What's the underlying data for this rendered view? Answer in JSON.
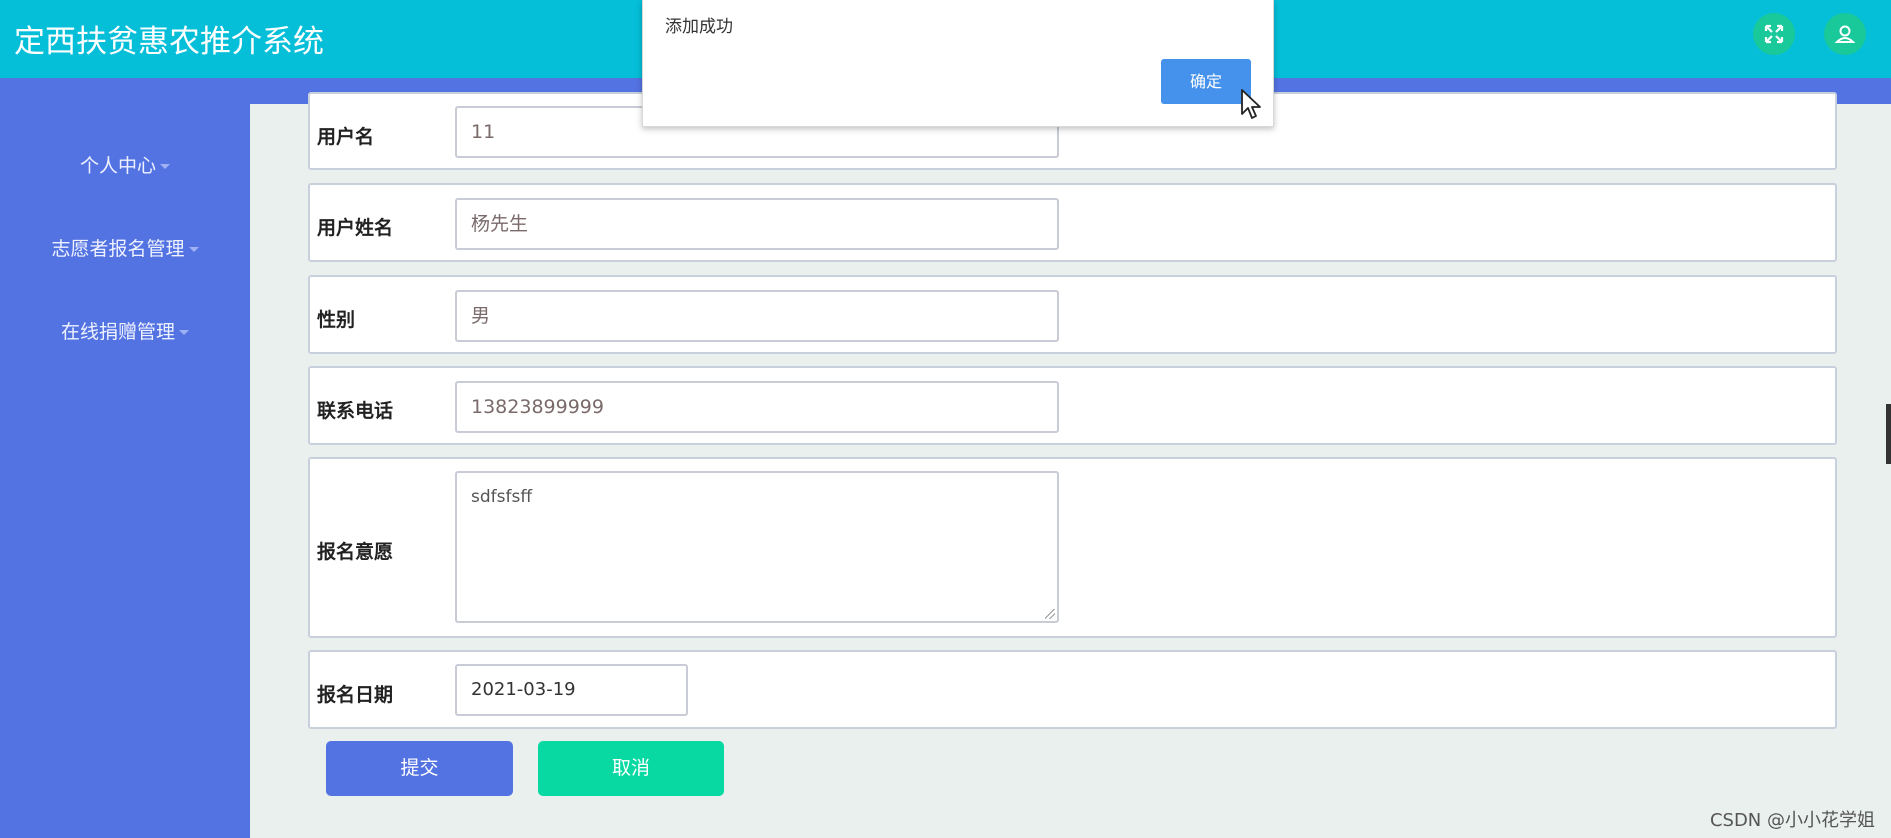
{
  "app": {
    "title": "定西扶贫惠农推介系统"
  },
  "header": {
    "fullscreen_icon": "fullscreen-icon",
    "user_icon": "user-icon"
  },
  "sidebar": {
    "items": [
      {
        "label": "个人中心"
      },
      {
        "label": "志愿者报名管理"
      },
      {
        "label": "在线捐赠管理"
      }
    ]
  },
  "form": {
    "username": {
      "label": "用户名",
      "value": "11"
    },
    "realname": {
      "label": "用户姓名",
      "value": "杨先生"
    },
    "gender": {
      "label": "性别",
      "value": "男"
    },
    "phone": {
      "label": "联系电话",
      "value": "13823899999"
    },
    "intention": {
      "label": "报名意愿",
      "value": "sdfsfsff"
    },
    "date": {
      "label": "报名日期",
      "value": "2021-03-19"
    },
    "submit_label": "提交",
    "cancel_label": "取消"
  },
  "dialog": {
    "message": "添加成功",
    "ok_label": "确定"
  },
  "watermark": "CSDN @小小花学姐",
  "colors": {
    "header": "#05bfd9",
    "sidebar": "#5473e2",
    "submit": "#5473e2",
    "cancel": "#08d9a3",
    "dialog_ok": "#4592ec"
  }
}
